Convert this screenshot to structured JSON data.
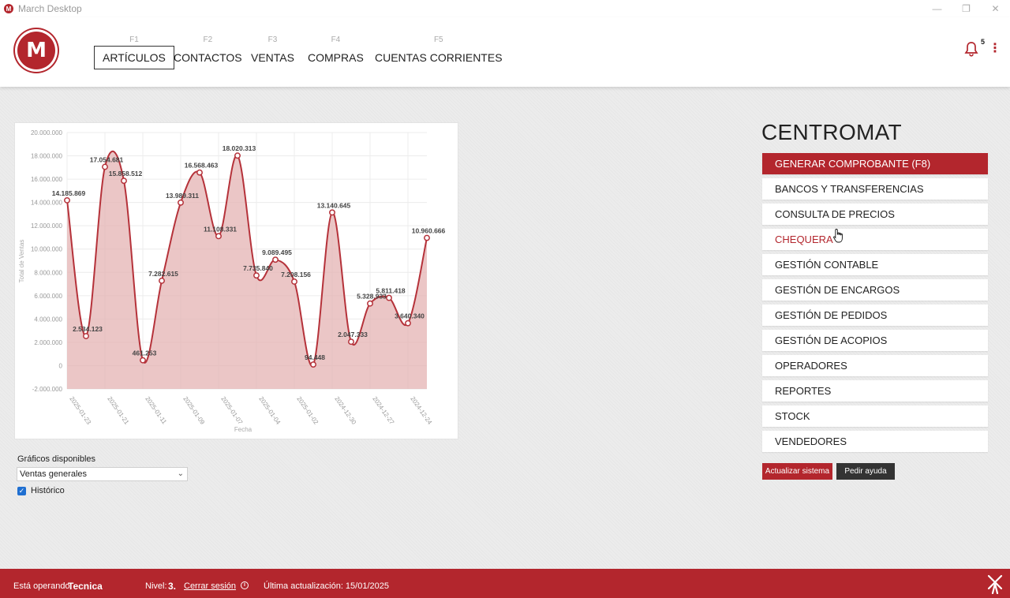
{
  "window": {
    "title": "March Desktop",
    "controls": [
      "—",
      "❐",
      "✕"
    ]
  },
  "logo": {
    "letter": "M"
  },
  "nav": [
    {
      "key": "F1",
      "label": "ARTÍCULOS",
      "active": true
    },
    {
      "key": "F2",
      "label": "CONTACTOS"
    },
    {
      "key": "F3",
      "label": "VENTAS"
    },
    {
      "key": "F4",
      "label": "COMPRAS"
    },
    {
      "key": "F5",
      "label": "CUENTAS CORRIENTES"
    }
  ],
  "notifications": {
    "count": "5",
    "icon": "bell-icon",
    "menu_icon": "kebab-menu-icon",
    "menu_glyph": "⋮"
  },
  "company": "CENTROMAT",
  "menu": [
    {
      "label": "GENERAR COMPROBANTE (F8)",
      "state": "primary"
    },
    {
      "label": "BANCOS Y TRANSFERENCIAS"
    },
    {
      "label": "CONSULTA DE PRECIOS"
    },
    {
      "label": "CHEQUERA",
      "state": "hover"
    },
    {
      "label": "GESTIÓN CONTABLE"
    },
    {
      "label": "GESTIÓN DE ENCARGOS"
    },
    {
      "label": "GESTIÓN DE PEDIDOS"
    },
    {
      "label": "GESTIÓN DE ACOPIOS"
    },
    {
      "label": "OPERADORES"
    },
    {
      "label": "REPORTES"
    },
    {
      "label": "STOCK"
    },
    {
      "label": "VENDEDORES"
    }
  ],
  "buttons": {
    "update": "Actualizar sistema",
    "help": "Pedir ayuda"
  },
  "charts_selector": {
    "label": "Gráficos disponibles",
    "selected": "Ventas generales",
    "historic_label": "Histórico",
    "historic_checked": true
  },
  "chart_data": {
    "type": "area",
    "xlabel": "Fecha",
    "ylabel": "Total de Ventas",
    "ylim": [
      -2000000,
      20000000
    ],
    "yticks": [
      "20.000.000",
      "18.000.000",
      "16.000.000",
      "14.000.000",
      "12.000.000",
      "10.000.000",
      "8.000.000",
      "6.000.000",
      "4.000.000",
      "2.000.000",
      "0",
      "-2.000.000"
    ],
    "xticks": [
      "2025-01-23",
      "2025-01-21",
      "2025-01-11",
      "2025-01-09",
      "2025-01-07",
      "2025-01-04",
      "2025-01-02",
      "2024-12-30",
      "2024-12-27",
      "2024-12-24"
    ],
    "series": [
      {
        "values": [
          14185869,
          2534123,
          17054681,
          15858512,
          461253,
          7282615,
          13989311,
          16568463,
          11108331,
          18020313,
          7735840,
          9089495,
          7208156,
          94448,
          13140645,
          2047333,
          5328933,
          5811418,
          3640340,
          10960666
        ],
        "labels": [
          "14.185.869",
          "2.534.123",
          "17.054.681",
          "15.858.512",
          "461.253",
          "7.282.615",
          "13.989.311",
          "16.568.463",
          "11.108.331",
          "18.020.313",
          "7.735.840",
          "9.089.495",
          "7.208.156",
          "94.448",
          "13.140.645",
          "2.047.333",
          "5.328.933",
          "5.811.418",
          "3.640.340",
          "10.960.666"
        ]
      }
    ],
    "colors": {
      "line": "#b5323a",
      "fill": "#e4b3b3"
    },
    "grid": true
  },
  "status": {
    "operating_label": "Está operando:",
    "operator": "Tecnica",
    "level_label": "Nivel:",
    "level": "3.",
    "logout": "Cerrar sesión",
    "last_update": "Última actualización: 15/01/2025"
  },
  "colors": {
    "accent": "#b3262d",
    "dark_button": "#333333"
  }
}
